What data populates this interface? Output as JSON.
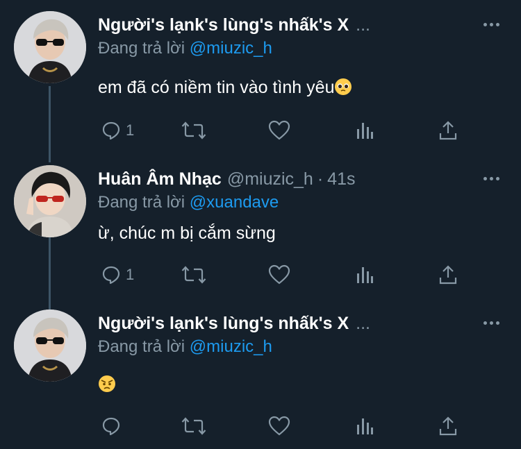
{
  "tweets": [
    {
      "name": "Người's lạnk's lùng's nhấk's X",
      "ellipsis": "...",
      "handle": "",
      "time": "",
      "reply_prefix": "Đang trả lời",
      "reply_to": "@miuzic_h",
      "text": "em đã có niềm tin vào tình yêu",
      "emoji": "pleading-face",
      "reply_count": "1",
      "retweet_count": "",
      "like_count": ""
    },
    {
      "name": "Huân Âm Nhạc",
      "ellipsis": "",
      "handle": "@miuzic_h",
      "dot": "·",
      "time": "41s",
      "reply_prefix": "Đang trả lời",
      "reply_to": "@xuandave",
      "text": "ừ, chúc m bị cắm sừng",
      "emoji": "",
      "reply_count": "1",
      "retweet_count": "",
      "like_count": ""
    },
    {
      "name": "Người's lạnk's lùng's nhấk's X",
      "ellipsis": "...",
      "handle": "",
      "time": "",
      "reply_prefix": "Đang trả lời",
      "reply_to": "@miuzic_h",
      "text": "",
      "emoji": "angry-face",
      "reply_count": "",
      "retweet_count": "",
      "like_count": ""
    }
  ],
  "colors": {
    "background": "#15202b",
    "secondary_text": "#8899a6",
    "accent": "#1d9bf0",
    "thread_line": "#3d5466"
  },
  "icons": [
    "reply-icon",
    "retweet-icon",
    "like-icon",
    "analytics-icon",
    "share-icon",
    "more-icon"
  ]
}
